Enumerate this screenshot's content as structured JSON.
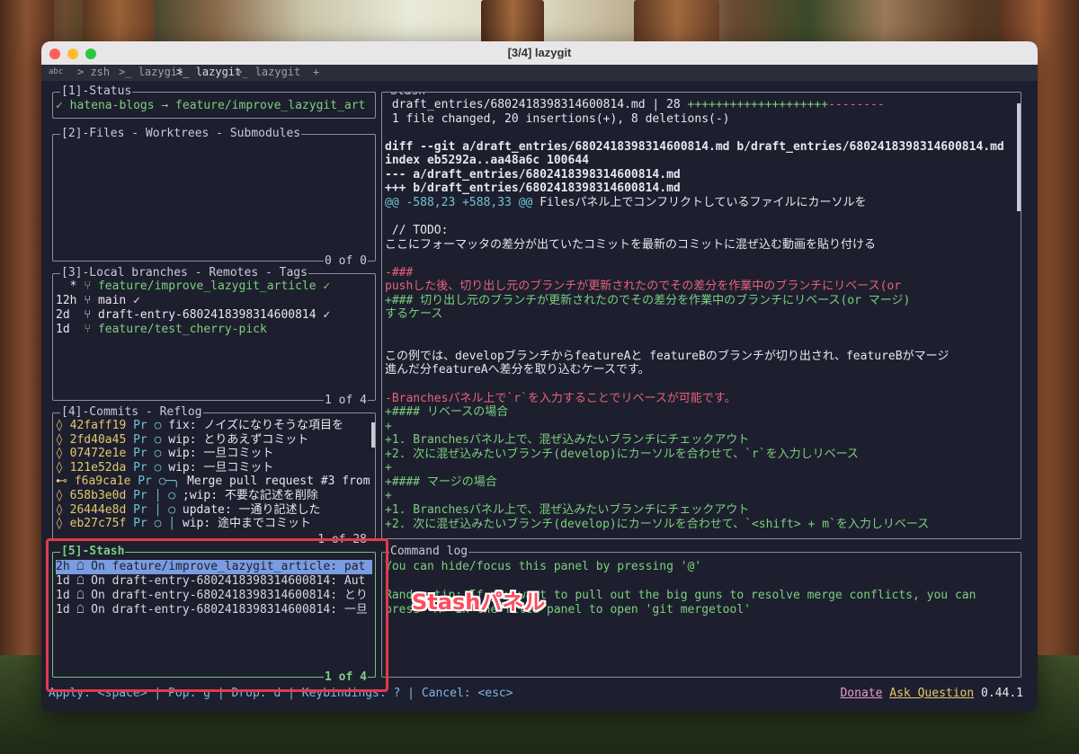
{
  "window": {
    "title": "[3/4] lazygit"
  },
  "tabs": {
    "prefix": "abc",
    "items": [
      "> zsh",
      "lazygit",
      "lazygit",
      "lazygit"
    ],
    "add": "+"
  },
  "status_panel": {
    "title": "[1]-Status",
    "line": "✓ hatena-blogs → feature/improve_lazygit_art"
  },
  "files_panel": {
    "title": "[2]-Files - Worktrees - Submodules",
    "footer": "0 of 0"
  },
  "branches_panel": {
    "title": "[3]-Local branches - Remotes - Tags",
    "footer": "1 of 4",
    "rows": [
      {
        "age": "  *",
        "name": "feature/improve_lazygit_article ✓"
      },
      {
        "age": "12h",
        "name": "main ✓"
      },
      {
        "age": "2d ",
        "name": "draft-entry-6802418398314600814 ✓"
      },
      {
        "age": "1d ",
        "name": "feature/test_cherry-pick"
      }
    ]
  },
  "commits_panel": {
    "title": "[4]-Commits - Reflog",
    "footer": "1 of 28",
    "rows": [
      {
        "sym": "◊",
        "hash": "42faff19",
        "author": "Pr",
        "graph": "○",
        "msg": "fix: ノイズになりそうな項目を"
      },
      {
        "sym": "◊",
        "hash": "2fd40a45",
        "author": "Pr",
        "graph": "○",
        "msg": "wip: とりあえずコミット"
      },
      {
        "sym": "◊",
        "hash": "07472e1e",
        "author": "Pr",
        "graph": "○",
        "msg": "wip: 一旦コミット"
      },
      {
        "sym": "◊",
        "hash": "121e52da",
        "author": "Pr",
        "graph": "○",
        "msg": "wip: 一旦コミット"
      },
      {
        "sym": "⊷",
        "hash": "f6a9ca1e",
        "author": "Pr",
        "graph": "○─╮",
        "msg": "Merge pull request #3 from"
      },
      {
        "sym": "◊",
        "hash": "658b3e0d",
        "author": "Pr",
        "graph": "│ ○",
        "msg": ";wip: 不要な記述を削除"
      },
      {
        "sym": "◊",
        "hash": "26444e8d",
        "author": "Pr",
        "graph": "│ ○",
        "msg": "update: 一通り記述した"
      },
      {
        "sym": "◊",
        "hash": "eb27c75f",
        "author": "Pr",
        "graph": "○ │",
        "msg": "wip: 途中までコミット"
      }
    ]
  },
  "stash_panel": {
    "title": "[5]-Stash",
    "footer": "1 of 4",
    "rows": [
      {
        "age": "2h",
        "text": "On feature/improve_lazygit_article: pat"
      },
      {
        "age": "1d",
        "text": "On draft-entry-6802418398314600814: Aut"
      },
      {
        "age": "1d",
        "text": "On draft-entry-6802418398314600814: とり"
      },
      {
        "age": "1d",
        "text": "On draft-entry-6802418398314600814: 一旦"
      }
    ]
  },
  "main_panel": {
    "title": "Stash",
    "lines": [
      {
        "t": " draft_entries/6802418398314600814.md | 28 ",
        "cls": "w",
        "tail_g": "++++++++++++++++++++",
        "tail_r": "--------"
      },
      {
        "t": " 1 file changed, 20 insertions(+), 8 deletions(-)",
        "cls": "w"
      },
      {
        "t": "",
        "cls": "w"
      },
      {
        "t": "diff --git a/draft_entries/6802418398314600814.md b/draft_entries/6802418398314600814.md",
        "cls": "w b"
      },
      {
        "t": "index eb5292a..aa48a6c 100644",
        "cls": "w b"
      },
      {
        "t": "--- a/draft_entries/6802418398314600814.md",
        "cls": "w b"
      },
      {
        "t": "+++ b/draft_entries/6802418398314600814.md",
        "cls": "w b"
      },
      {
        "t": "@@ -588,23 +588,33 @@",
        "cls": "c",
        "tail_w": " Filesパネル上でコンフリクトしているファイルにカーソルを"
      },
      {
        "t": "",
        "cls": "w"
      },
      {
        "t": " // TODO:",
        "cls": "w"
      },
      {
        "t": "ここにフォーマッタの差分が出ていたコミットを最新のコミットに混ぜ込む動画を貼り付ける",
        "cls": "w"
      },
      {
        "t": "",
        "cls": "w"
      },
      {
        "t": "-###",
        "cls": "r"
      },
      {
        "t": "pushした後、切り出し元のブランチが更新されたのでその差分を作業中のブランチにリベース(or",
        "cls": "r"
      },
      {
        "t": "+### 切り出し元のブランチが更新されたのでその差分を作業中のブランチにリベース(or マージ)",
        "cls": "g"
      },
      {
        "t": "するケース",
        "cls": "g"
      },
      {
        "t": "",
        "cls": "w"
      },
      {
        "t": "",
        "cls": "w"
      },
      {
        "t": "この例では、developブランチからfeatureAと featureBのブランチが切り出され、featureBがマージ",
        "cls": "w"
      },
      {
        "t": "進んだ分featureAへ差分を取り込むケースです。",
        "cls": "w"
      },
      {
        "t": "",
        "cls": "w"
      },
      {
        "t": "-Branchesパネル上で`r`を入力することでリベースが可能です。",
        "cls": "r"
      },
      {
        "t": "+#### リベースの場合",
        "cls": "g"
      },
      {
        "t": "+",
        "cls": "g"
      },
      {
        "t": "+1. Branchesパネル上で、混ぜ込みたいブランチにチェックアウト",
        "cls": "g"
      },
      {
        "t": "+2. 次に混ぜ込みたいブランチ(develop)にカーソルを合わせて、`r`を入力しリベース",
        "cls": "g"
      },
      {
        "t": "+",
        "cls": "g"
      },
      {
        "t": "+#### マージの場合",
        "cls": "g"
      },
      {
        "t": "+",
        "cls": "g"
      },
      {
        "t": "+1. Branchesパネル上で、混ぜ込みたいブランチにチェックアウト",
        "cls": "g"
      },
      {
        "t": "+2. 次に混ぜ込みたいブランチ(develop)にカーソルを合わせて、`<shift> + m`を入力しリベース",
        "cls": "g"
      }
    ]
  },
  "command_log": {
    "title": "Command log",
    "lines": [
      "You can hide/focus this panel by pressing '@'",
      "",
      "Random tip: If you want to pull out the big guns to resolve merge conflicts, you can",
      "press 'M' in the files panel to open 'git mergetool'"
    ]
  },
  "statusbar": {
    "keys": "Apply: <space> | Pop: g | Drop: d | Keybindings: ? | Cancel: <esc>",
    "donate": "Donate",
    "ask": "Ask Question",
    "version": "0.44.1"
  },
  "annotation": {
    "label": "Stashパネル"
  },
  "colors": {
    "accent_green": "#7ccf7e",
    "selection": "#7a9ce0",
    "highlight_box": "#e23a48"
  }
}
